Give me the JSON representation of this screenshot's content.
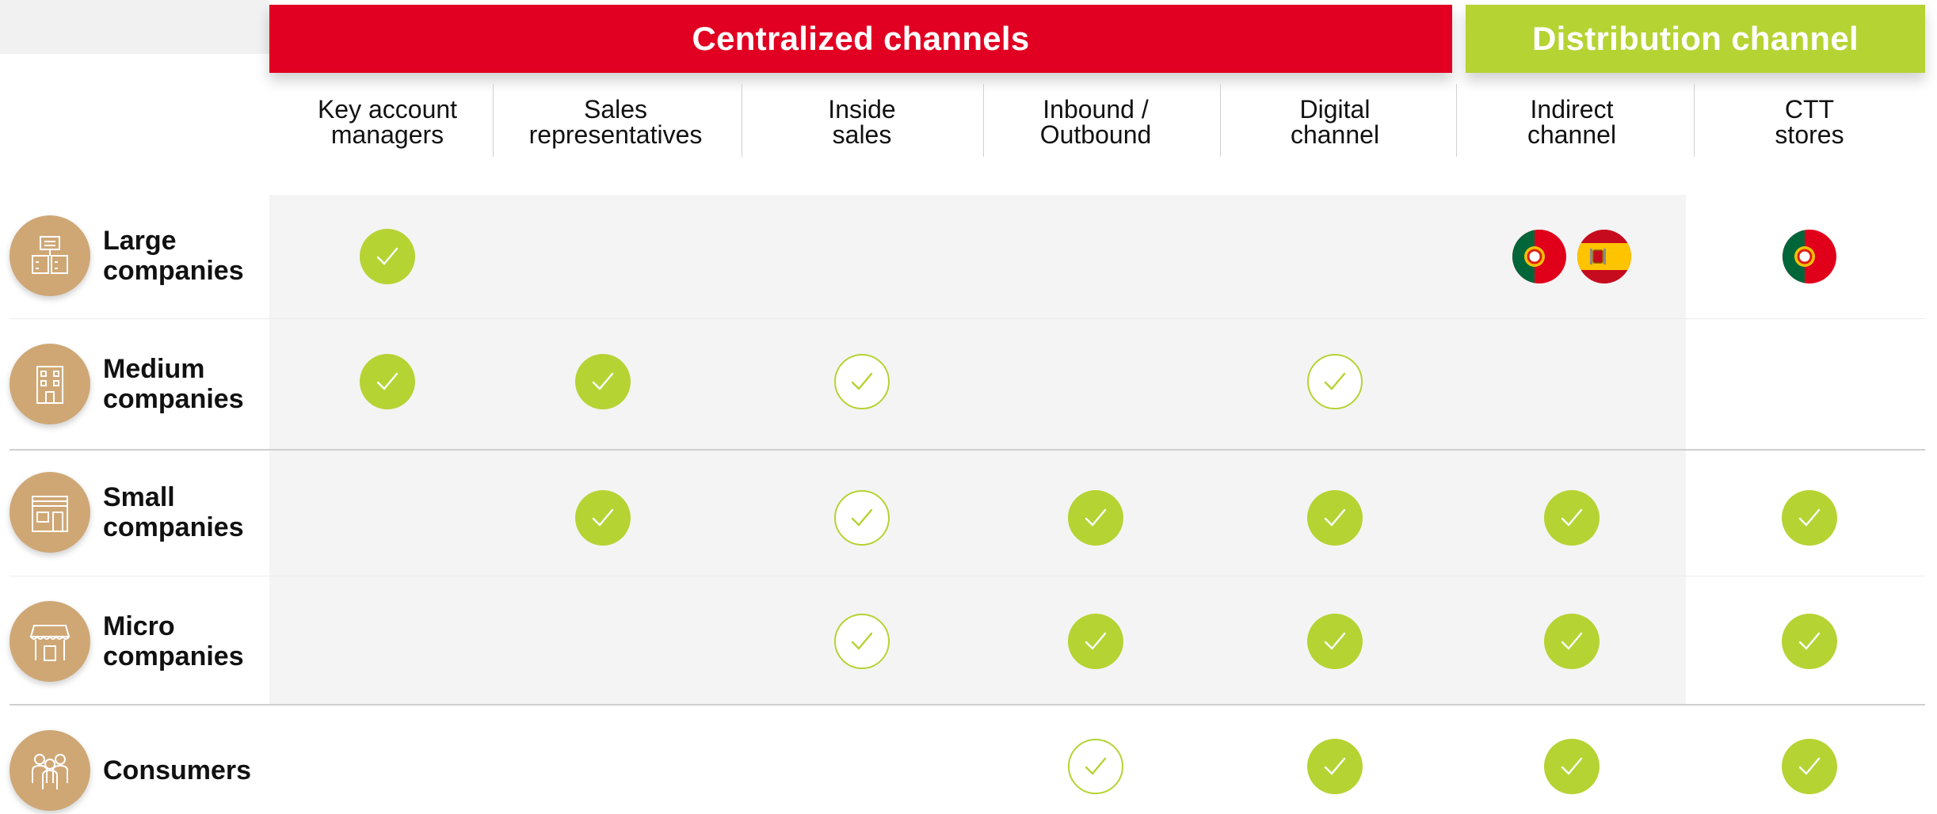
{
  "banners": {
    "centralized": "Centralized channels",
    "distribution": "Distribution channel"
  },
  "colors": {
    "red": "#e10022",
    "green": "#b5d333",
    "avatar": "#cfa775",
    "shade": "#f4f4f4"
  },
  "columns": [
    "Key account\nmanagers",
    "Sales\nrepresentatives",
    "Inside\nsales",
    "Inbound /\nOutbound",
    "Digital\nchannel",
    "Indirect\nchannel",
    "CTT\nstores"
  ],
  "rows": [
    {
      "label": "Large\ncompanies",
      "icon": "office-building-icon",
      "cells": [
        "full",
        "",
        "",
        "",
        "",
        "flags:pt,es",
        "flags:pt"
      ]
    },
    {
      "label": "Medium\ncompanies",
      "icon": "building-icon",
      "cells": [
        "full",
        "full",
        "outline",
        "",
        "outline",
        "",
        ""
      ]
    },
    {
      "label": "Small\ncompanies",
      "icon": "shop-icon",
      "cells": [
        "",
        "full",
        "outline",
        "full",
        "full",
        "full",
        "full"
      ]
    },
    {
      "label": "Micro\ncompanies",
      "icon": "store-awning-icon",
      "cells": [
        "",
        "",
        "outline",
        "full",
        "full",
        "full",
        "full"
      ]
    },
    {
      "label": "Consumers",
      "icon": "people-group-icon",
      "cells": [
        "",
        "",
        "",
        "outline",
        "full",
        "full",
        "full"
      ]
    }
  ],
  "legend": {
    "full": "full-check-icon",
    "outline": "outline-check-icon",
    "pt": "portugal-flag-icon",
    "es": "spain-flag-icon"
  }
}
